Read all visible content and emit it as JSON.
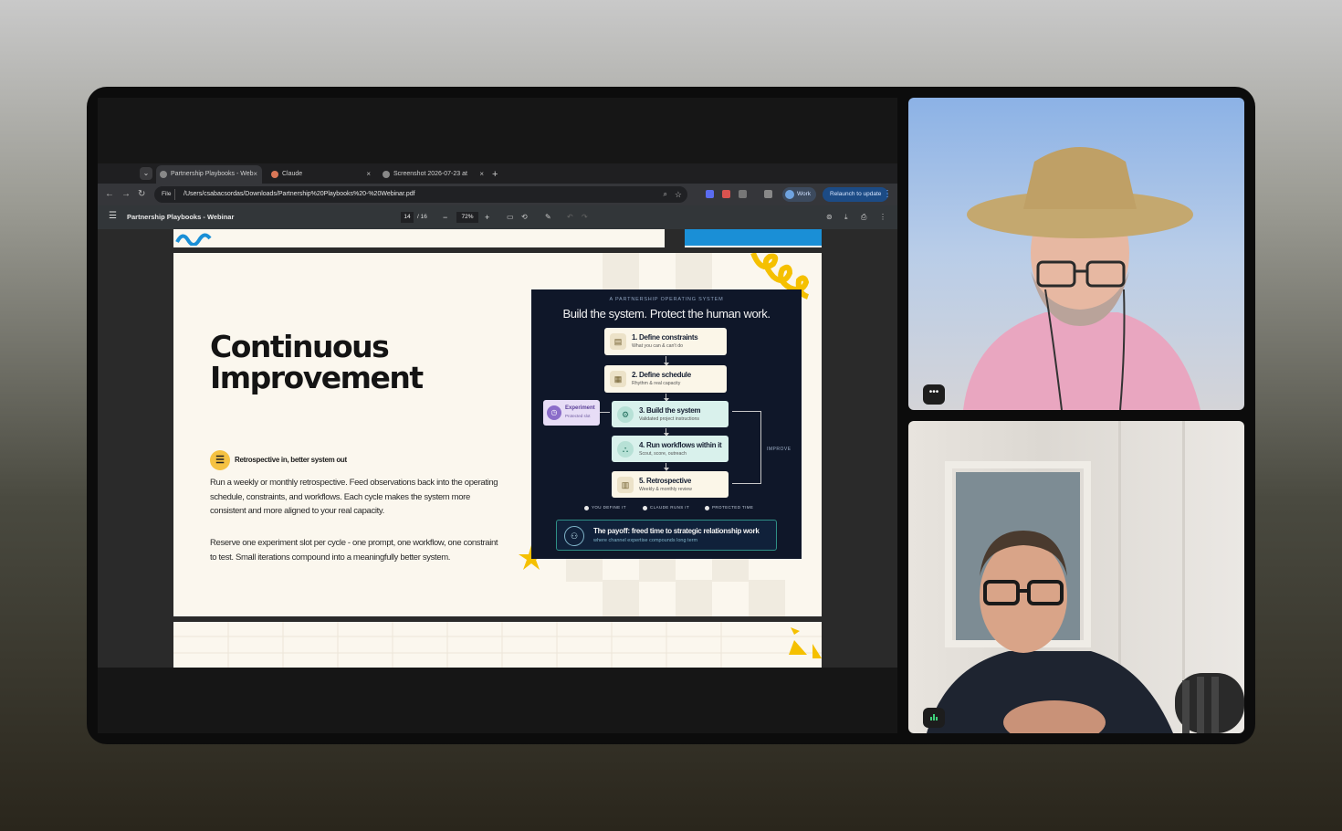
{
  "browser": {
    "tabs": [
      {
        "label": "Partnership Playbooks - Web",
        "active": true
      },
      {
        "label": "Claude",
        "active": false
      },
      {
        "label": "Screenshot 2026-07-23 at",
        "active": false
      }
    ],
    "new_tab": "+",
    "close_glyph": "×",
    "url_chip": "File",
    "url": "/Users/csabacsordas/Downloads/Partnership%20Playbooks%20-%20Webinar.pdf",
    "profile_label": "Work",
    "relaunch_label": "Relaunch to update"
  },
  "pdf": {
    "title": "Partnership Playbooks - Webinar",
    "page_current": "14",
    "page_total": "/  16",
    "zoom": "72%",
    "zoom_out": "−",
    "zoom_in": "+"
  },
  "slide": {
    "heading_line1": "Continuous",
    "heading_line2": "Improvement",
    "section_title": "Retrospective in, better system out",
    "paragraph1": "Run a weekly or monthly retrospective. Feed observations back into the operating schedule, constraints, and workflows. Each cycle makes the system more consistent and more aligned to your real capacity.",
    "paragraph2": "Reserve one experiment slot per cycle - one prompt, one workflow, one constraint to test. Small iterations compound into a meaningfully better system."
  },
  "diagram": {
    "kicker": "A PARTNERSHIP OPERATING SYSTEM",
    "headline": "Build the system. Protect the human work.",
    "steps": [
      {
        "title": "1. Define constraints",
        "sub": "What you can & can't do"
      },
      {
        "title": "2. Define schedule",
        "sub": "Rhythm & real capacity"
      },
      {
        "title": "3. Build the system",
        "sub": "Validated project instructions"
      },
      {
        "title": "4. Run workflows within it",
        "sub": "Scout, score, outreach"
      },
      {
        "title": "5. Retrospective",
        "sub": "Weekly & monthly review"
      }
    ],
    "experiment_title": "Experiment",
    "experiment_sub": "Protected slot",
    "improve_label": "IMPROVE",
    "legend": [
      "YOU DEFINE IT",
      "CLAUDE RUNS IT",
      "PROTECTED TIME"
    ],
    "payoff_title": "The payoff: freed time to strategic relationship work",
    "payoff_sub": "where channel expertise compounds long term"
  },
  "video": {
    "more_glyph": "•••"
  },
  "colors": {
    "accent_yellow": "#f5c242",
    "card_navy": "#0f1729",
    "teal_border": "#2e8f86",
    "purple": "#8b6dc9",
    "blue_block": "#1a8fd6"
  }
}
